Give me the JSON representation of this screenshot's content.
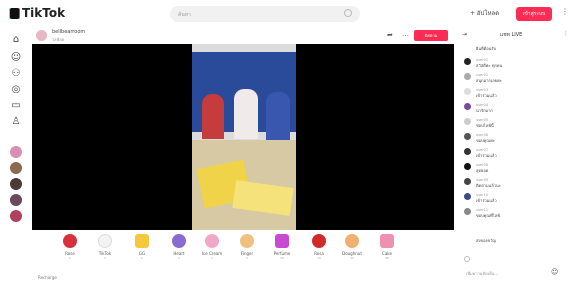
{
  "header": {
    "brand": "TikTok",
    "search_placeholder": "ค้นหา",
    "upload_label": "+ อัปโหลด",
    "login_label": "เข้าสู่ระบบ"
  },
  "stream": {
    "host_name": "bellbearroom",
    "host_status": "ไลฟ์สด",
    "follow_label": "ติดตาม"
  },
  "sidebar": {
    "icons": [
      "home-icon",
      "following-icon",
      "friends-icon",
      "explore-icon",
      "live-icon",
      "profile-icon"
    ]
  },
  "gifts": [
    {
      "label": "Rose",
      "price": "1"
    },
    {
      "label": "TikTok",
      "price": "1"
    },
    {
      "label": "GG",
      "price": "1"
    },
    {
      "label": "Heart",
      "price": "1"
    },
    {
      "label": "Ice Cream",
      "price": "1"
    },
    {
      "label": "Finger",
      "price": "5"
    },
    {
      "label": "Perfume",
      "price": "20"
    },
    {
      "label": "Rosa",
      "price": "10"
    },
    {
      "label": "Doughnut",
      "price": "30"
    },
    {
      "label": "Cake",
      "price": "99"
    }
  ],
  "bottom_text": "Recharge",
  "chat": {
    "title": "แชท LIVE",
    "messages": [
      {
        "name": "",
        "text": "ยินดีต้อนรับ"
      },
      {
        "name": "user01",
        "text": "สวัสดีค่ะ ทุกคน"
      },
      {
        "name": "user02",
        "text": "สนุกมากเลยค่ะ"
      },
      {
        "name": "user03",
        "text": "เข้าร่วมแล้ว"
      },
      {
        "name": "user04",
        "text": "น่ารักมาก"
      },
      {
        "name": "user05",
        "text": "ชอบไลฟ์นี้"
      },
      {
        "name": "user06",
        "text": "ขอบคุณค่ะ"
      },
      {
        "name": "user07",
        "text": "เข้าร่วมแล้ว"
      },
      {
        "name": "user08",
        "text": "สุดยอด"
      },
      {
        "name": "user09",
        "text": "ติดตามแล้วนะ"
      },
      {
        "name": "user10",
        "text": "เข้าร่วมแล้ว"
      },
      {
        "name": "user11",
        "text": "ขอบคุณที่ไลฟ์"
      },
      {
        "name": "",
        "text": "ส่งของขวัญ"
      }
    ],
    "input_placeholder": "เพิ่มความคิดเห็น..."
  }
}
